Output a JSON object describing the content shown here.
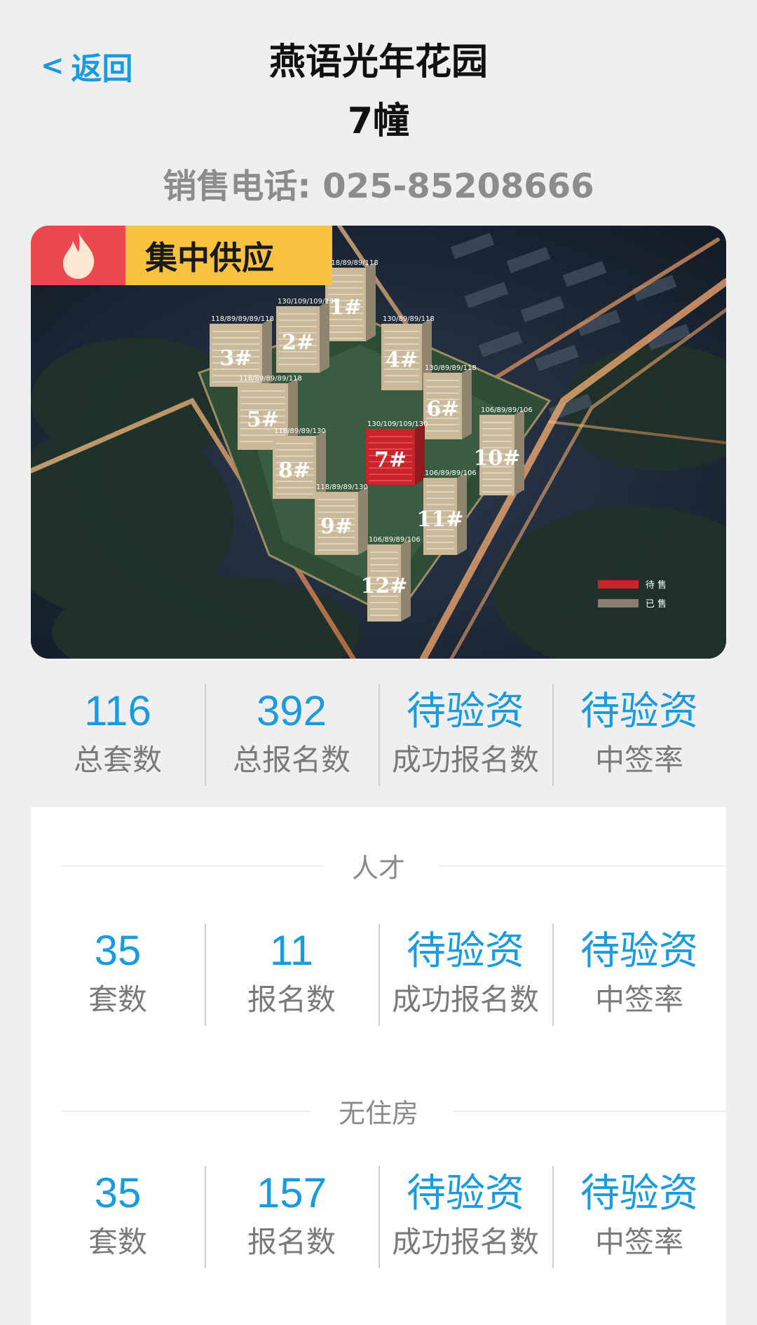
{
  "header": {
    "back_label": "返回",
    "title": "燕语光年花园",
    "building": "7幢",
    "phone": "销售电话: 025-85208666"
  },
  "hero": {
    "badge": "集中供应",
    "legend": [
      {
        "label": "待 售",
        "color": "#c8232b"
      },
      {
        "label": "已 售",
        "color": "#8a7f6e"
      }
    ],
    "buildings": [
      {
        "label": "1#",
        "sizes": "118/89/89/118",
        "status": "已售"
      },
      {
        "label": "2#",
        "sizes": "130/109/109/130",
        "status": "已售"
      },
      {
        "label": "3#",
        "sizes": "118/89/89/89/118",
        "status": "已售"
      },
      {
        "label": "4#",
        "sizes": "130/89/89/118",
        "status": "已售"
      },
      {
        "label": "5#",
        "sizes": "118/89/89/89/118",
        "status": "已售"
      },
      {
        "label": "6#",
        "sizes": "130/89/89/118",
        "status": "已售"
      },
      {
        "label": "7#",
        "sizes": "130/109/109/130",
        "status": "待售"
      },
      {
        "label": "8#",
        "sizes": "118/89/89/130",
        "status": "已售"
      },
      {
        "label": "9#",
        "sizes": "118/89/89/130",
        "status": "已售"
      },
      {
        "label": "10#",
        "sizes": "106/89/89/106",
        "status": "已售"
      },
      {
        "label": "11#",
        "sizes": "106/89/89/106",
        "status": "已售"
      },
      {
        "label": "12#",
        "sizes": "106/89/89/106",
        "status": "已售"
      }
    ]
  },
  "summary": [
    {
      "value": "116",
      "caption": "总套数"
    },
    {
      "value": "392",
      "caption": "总报名数"
    },
    {
      "value": "待验资",
      "caption": "成功报名数"
    },
    {
      "value": "待验资",
      "caption": "中签率"
    }
  ],
  "sections": [
    {
      "title": "人才",
      "stats": [
        {
          "value": "35",
          "caption": "套数"
        },
        {
          "value": "11",
          "caption": "报名数"
        },
        {
          "value": "待验资",
          "caption": "成功报名数"
        },
        {
          "value": "待验资",
          "caption": "中签率"
        }
      ]
    },
    {
      "title": "无住房",
      "stats": [
        {
          "value": "35",
          "caption": "套数"
        },
        {
          "value": "157",
          "caption": "报名数"
        },
        {
          "value": "待验资",
          "caption": "成功报名数"
        },
        {
          "value": "待验资",
          "caption": "中签率"
        }
      ]
    }
  ],
  "colors": {
    "accent": "#1a9be0",
    "caption": "#7a7a7a",
    "background": "#efefef"
  }
}
